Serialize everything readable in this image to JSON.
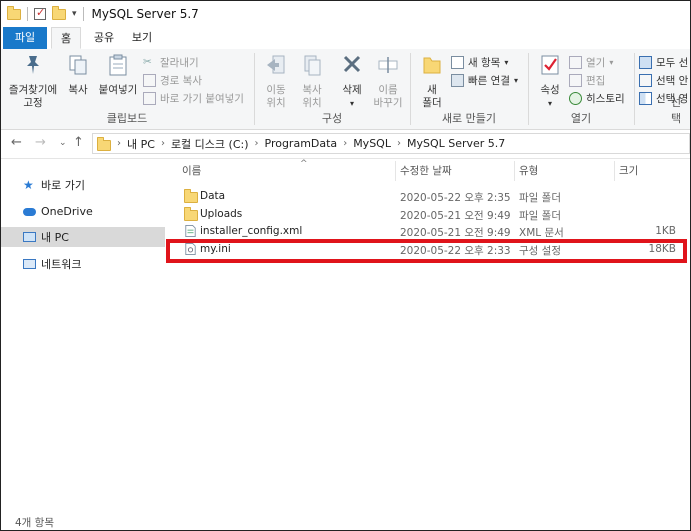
{
  "window": {
    "title": "MySQL Server 5.7"
  },
  "tabs": [
    {
      "label": "파일"
    },
    {
      "label": "홈"
    },
    {
      "label": "공유"
    },
    {
      "label": "보기"
    }
  ],
  "ribbon": {
    "clipboard": {
      "label": "클립보드",
      "pin": "즐겨찾기에\n고정",
      "copy": "복사",
      "paste": "붙여넣기",
      "cut": "잘라내기",
      "copy_path": "경로 복사",
      "paste_shortcut": "바로 가기 붙여넣기"
    },
    "organize": {
      "label": "구성",
      "move_to": "이동\n위치",
      "copy_to": "복사\n위치",
      "delete": "삭제",
      "rename": "이름\n바꾸기"
    },
    "new": {
      "label": "새로 만들기",
      "new_folder": "새\n폴더",
      "new_item": "새 항목",
      "easy_access": "빠른 연결"
    },
    "open": {
      "label": "열기",
      "properties": "속성",
      "open": "열기",
      "edit": "편집",
      "history": "히스토리"
    },
    "select": {
      "label": "선택",
      "select_all": "모두 선",
      "select_none": "선택 안",
      "invert": "선택 영"
    }
  },
  "breadcrumb": [
    "내 PC",
    "로컬 디스크 (C:)",
    "ProgramData",
    "MySQL",
    "MySQL Server 5.7"
  ],
  "nav": [
    {
      "label": "바로 가기",
      "icon": "star-icon"
    },
    {
      "label": "OneDrive",
      "icon": "cloud-icon"
    },
    {
      "label": "내 PC",
      "icon": "computer-icon"
    },
    {
      "label": "네트워크",
      "icon": "network-icon"
    }
  ],
  "columns": {
    "name": "이름",
    "date": "수정한 날짜",
    "type": "유형",
    "size": "크기"
  },
  "files": [
    {
      "name": "Data",
      "date": "2020-05-22 오후 2:35",
      "type": "파일 폴더",
      "size": "",
      "icon": "folder-icon"
    },
    {
      "name": "Uploads",
      "date": "2020-05-21 오전 9:49",
      "type": "파일 폴더",
      "size": "",
      "icon": "folder-icon"
    },
    {
      "name": "installer_config.xml",
      "date": "2020-05-21 오전 9:49",
      "type": "XML 문서",
      "size": "1KB",
      "icon": "xml-file-icon"
    },
    {
      "name": "my.ini",
      "date": "2020-05-22 오후 2:33",
      "type": "구성 설정",
      "size": "18KB",
      "icon": "ini-file-icon"
    }
  ],
  "status": {
    "items": "4개 항목"
  },
  "colors": {
    "accent": "#1979ca",
    "highlight": "#e0141b",
    "folder": "#f8d775"
  }
}
